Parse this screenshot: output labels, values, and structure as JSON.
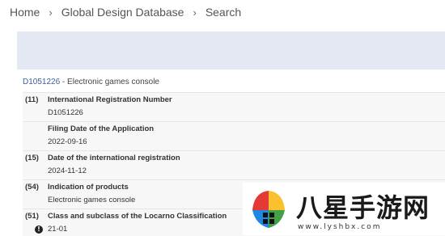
{
  "breadcrumb": [
    "Home",
    "Global Design Database",
    "Search"
  ],
  "breadcrumb_separator": "›",
  "record": {
    "id": "D1051226",
    "separator": " - ",
    "title": "Electronic games console"
  },
  "fields": [
    {
      "code": "(11)",
      "label": "International Registration Number",
      "value": "D1051226"
    },
    {
      "code": "",
      "label": "Filing Date of the Application",
      "value": "2022-09-16"
    },
    {
      "code": "(15)",
      "label": "Date of the international registration",
      "value": "2024-11-12"
    },
    {
      "code": "(54)",
      "label": "Indication of products",
      "value": "Electronic games console"
    },
    {
      "code": "(51)",
      "label": "Class and subclass of the Locarno Classification",
      "value": "21-01",
      "icon": "info-icon",
      "icon_glyph": "!"
    }
  ],
  "watermark": {
    "text": "八星手游网",
    "url": "www.lyshbx.com",
    "colors": {
      "red": "#e53935",
      "yellow": "#fbc02d",
      "blue": "#1e88e5",
      "green": "#43a047"
    }
  }
}
